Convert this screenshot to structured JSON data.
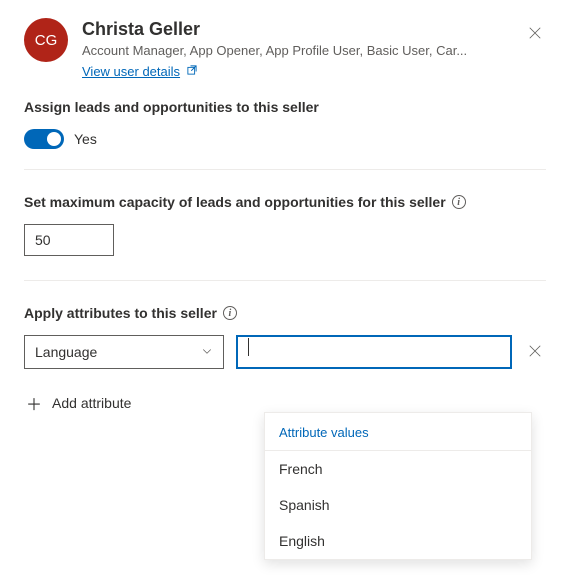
{
  "user": {
    "initials": "CG",
    "name": "Christa Geller",
    "roles": "Account Manager, App Opener, App Profile User, Basic User, Car...",
    "view_link": "View user details"
  },
  "assign": {
    "label": "Assign leads and opportunities to this seller",
    "toggle_value": "Yes"
  },
  "capacity": {
    "label": "Set maximum capacity of leads and opportunities for this seller",
    "value": "50"
  },
  "attributes": {
    "label": "Apply attributes to this seller",
    "selected_key": "Language",
    "value_input": "",
    "add_label": "Add attribute",
    "dropdown_header": "Attribute values",
    "options": [
      "French",
      "Spanish",
      "English"
    ]
  }
}
